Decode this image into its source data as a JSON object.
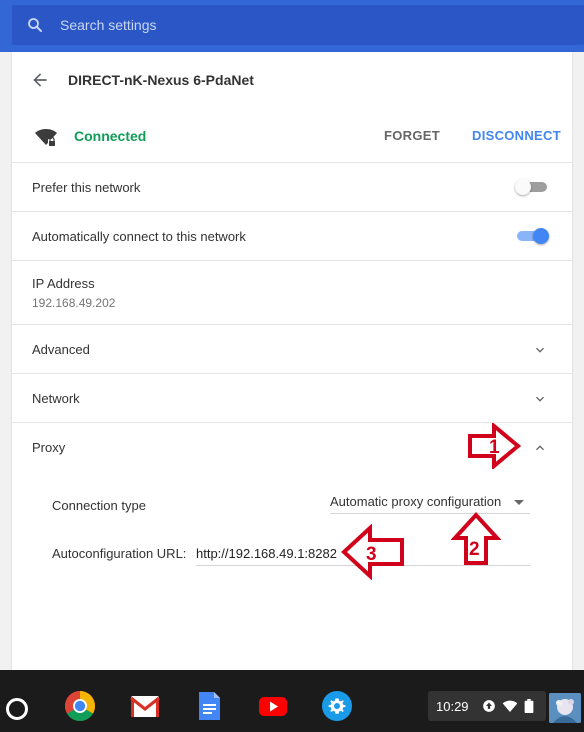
{
  "search": {
    "placeholder": "Search settings"
  },
  "network": {
    "name": "DIRECT-nK-Nexus 6-PdaNet",
    "status": "Connected",
    "forget_label": "FORGET",
    "disconnect_label": "DISCONNECT"
  },
  "settings": {
    "prefer_label": "Prefer this network",
    "prefer_enabled": false,
    "auto_connect_label": "Automatically connect to this network",
    "auto_connect_enabled": true,
    "ip_label": "IP Address",
    "ip_value": "192.168.49.202",
    "advanced_label": "Advanced",
    "network_label": "Network",
    "proxy_label": "Proxy"
  },
  "proxy": {
    "connection_type_label": "Connection type",
    "connection_type_value": "Automatic proxy configuration",
    "autoconfig_label": "Autoconfiguration URL:",
    "autoconfig_value": "http://192.168.49.1:8282"
  },
  "annotations": {
    "one": "1",
    "two": "2",
    "three": "3"
  },
  "shelf": {
    "apps": [
      "chrome-icon",
      "gmail-icon",
      "docs-icon",
      "youtube-icon",
      "settings-icon"
    ],
    "time": "10:29"
  },
  "colors": {
    "accent": "#4285f4",
    "connected": "#0f9d58",
    "annotation": "#d0021b",
    "topbar": "#3367d6"
  }
}
